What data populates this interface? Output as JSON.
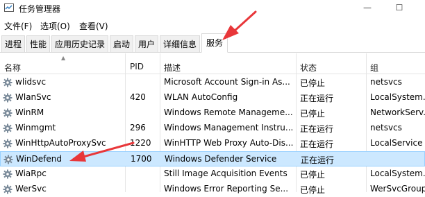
{
  "window": {
    "title": "任务管理器",
    "controls": {
      "minimize": "—",
      "maximize": "☐"
    }
  },
  "menu": [
    "文件(F)",
    "选项(O)",
    "查看(V)"
  ],
  "tabs": [
    "进程",
    "性能",
    "应用历史记录",
    "启动",
    "用户",
    "详细信息",
    "服务"
  ],
  "active_tab": "服务",
  "columns": [
    "名称",
    "PID",
    "描述",
    "状态",
    "组"
  ],
  "rows": [
    {
      "name": "wlidsvc",
      "pid": "",
      "desc": "Microsoft Account Sign-in As...",
      "status": "已停止",
      "group": "netsvcs"
    },
    {
      "name": "WlanSvc",
      "pid": "420",
      "desc": "WLAN AutoConfig",
      "status": "正在运行",
      "group": "LocalSystem..."
    },
    {
      "name": "WinRM",
      "pid": "",
      "desc": "Windows Remote Manageme...",
      "status": "已停止",
      "group": "NetworkServ..."
    },
    {
      "name": "Winmgmt",
      "pid": "296",
      "desc": "Windows Management Instru...",
      "status": "正在运行",
      "group": "netsvcs"
    },
    {
      "name": "WinHttpAutoProxySvc",
      "pid": "1220",
      "desc": "WinHTTP Web Proxy Auto-Dis...",
      "status": "正在运行",
      "group": "LocalService"
    },
    {
      "name": "WinDefend",
      "pid": "1700",
      "desc": "Windows Defender Service",
      "status": "正在运行",
      "group": ""
    },
    {
      "name": "WiaRpc",
      "pid": "",
      "desc": "Still Image Acquisition Events",
      "status": "已停止",
      "group": "LocalSystem..."
    },
    {
      "name": "WerSvc",
      "pid": "",
      "desc": "Windows Error Reporting Se...",
      "status": "已停止",
      "group": "WerSvcGroup"
    }
  ],
  "selected_row": 5,
  "colors": {
    "selection": "#cce8ff",
    "annotation": "#e8373a"
  },
  "icons": {
    "app": "task-manager-icon",
    "service": "gear-icon",
    "sort": "sort-up-icon"
  }
}
